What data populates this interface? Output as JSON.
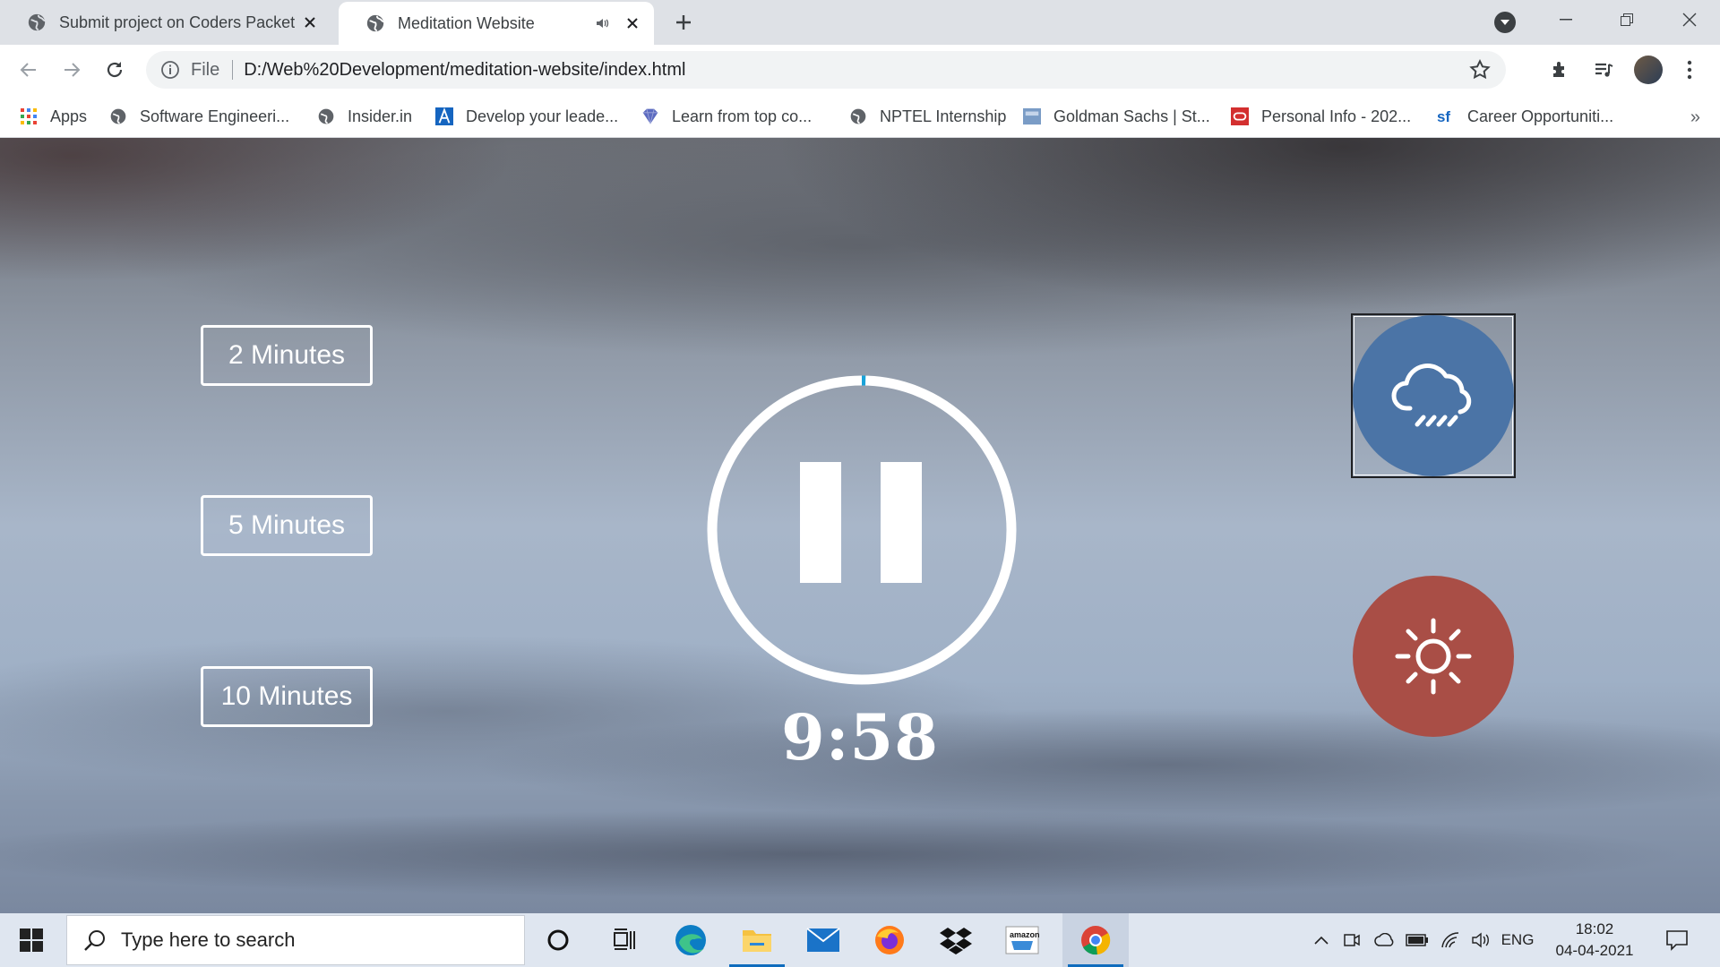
{
  "browser": {
    "tabs": [
      {
        "title": "Submit project on Coders Packet",
        "active": false
      },
      {
        "title": "Meditation Website",
        "active": true
      }
    ],
    "address": {
      "scheme_label": "File",
      "url": "D:/Web%20Development/meditation-website/index.html"
    },
    "bookmarks": [
      {
        "label": "Apps",
        "icon": "apps-grid-icon"
      },
      {
        "label": "Software Engineeri...",
        "icon": "globe-icon"
      },
      {
        "label": "Insider.in",
        "icon": "globe-icon"
      },
      {
        "label": "Develop your leade...",
        "icon": "a-logo-icon"
      },
      {
        "label": "Learn from top co...",
        "icon": "diamond-logo-icon"
      },
      {
        "label": "NPTEL Internship",
        "icon": "globe-icon"
      },
      {
        "label": "Goldman Sachs | St...",
        "icon": "gs-logo-icon"
      },
      {
        "label": "Personal Info - 202...",
        "icon": "oracle-logo-icon"
      },
      {
        "label": "Career Opportuniti...",
        "icon": "sf-logo-icon"
      }
    ],
    "more_bookmarks": "»"
  },
  "page": {
    "duration_buttons": [
      "2 Minutes",
      "5 Minutes",
      "10 Minutes"
    ],
    "timer": "9:58",
    "play_state": "playing",
    "progress": 0.0033,
    "sound_options": [
      {
        "name": "rain",
        "icon": "rain-cloud-icon",
        "color": "#4b74a6",
        "selected": true
      },
      {
        "name": "sunny",
        "icon": "sun-icon",
        "color": "#a94e46",
        "selected": false
      }
    ]
  },
  "taskbar": {
    "search_placeholder": "Type here to search",
    "language": "ENG",
    "time": "18:02",
    "date": "04-04-2021",
    "apps": [
      "cortana-icon",
      "task-view-icon",
      "edge-icon",
      "file-explorer-icon",
      "mail-icon",
      "firefox-icon",
      "dropbox-icon",
      "amazon-icon",
      "chrome-icon"
    ]
  },
  "colors": {
    "progress_accent": "#1aa3d9",
    "ring": "#ffffff"
  }
}
